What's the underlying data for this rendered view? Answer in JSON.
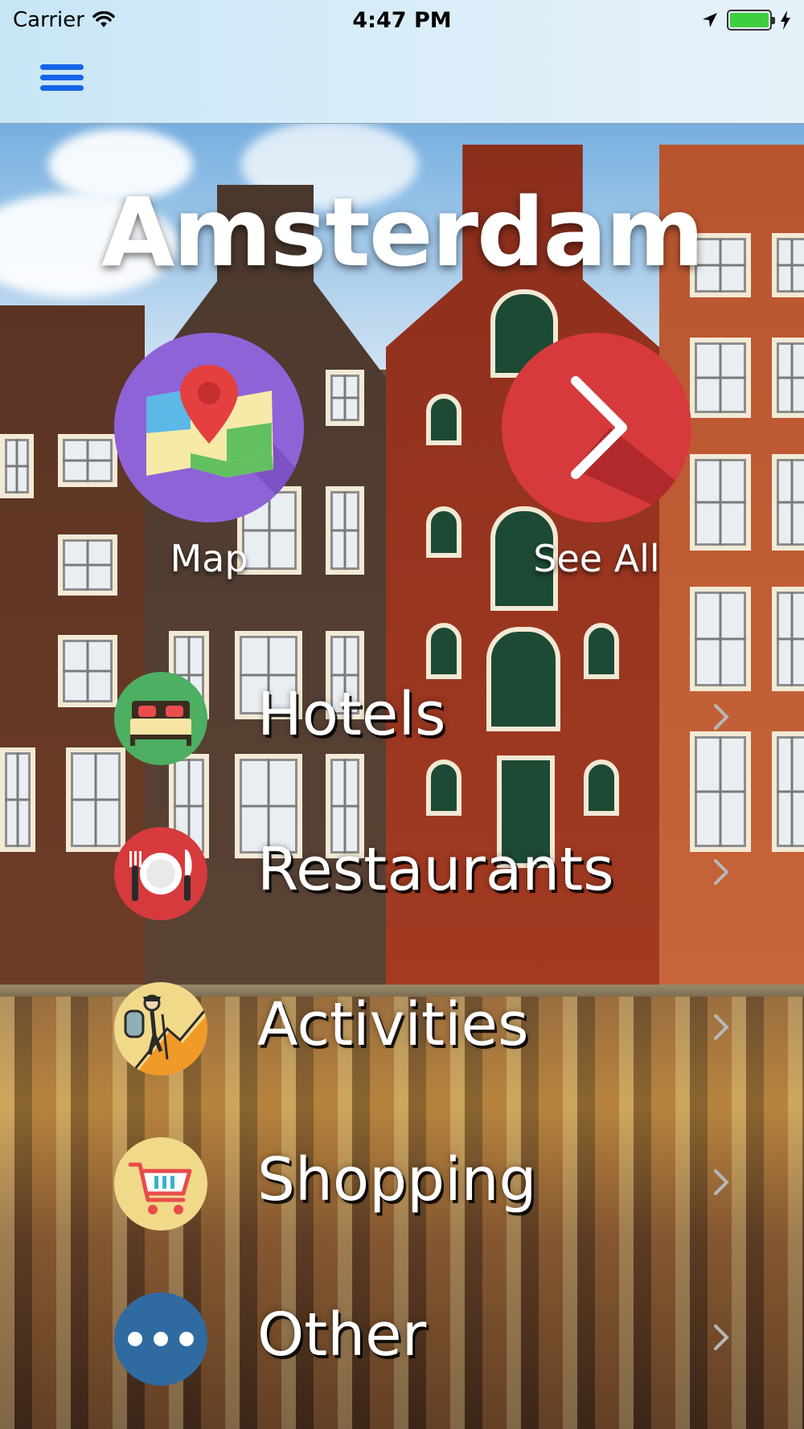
{
  "status_bar": {
    "carrier": "Carrier",
    "time": "4:47 PM",
    "battery_level": 1.0
  },
  "nav": {
    "menu_icon": "hamburger-menu-icon",
    "accent_color": "#1664e8"
  },
  "city": {
    "name": "Amsterdam"
  },
  "primary_actions": [
    {
      "label": "Map",
      "icon": "map-pin-icon",
      "color": "#8e63d8"
    },
    {
      "label": "See All",
      "icon": "chevron-right-icon",
      "color": "#d63a3c"
    }
  ],
  "categories": [
    {
      "label": "Hotels",
      "icon": "bed-icon",
      "color": "#4caf62"
    },
    {
      "label": "Restaurants",
      "icon": "plate-cutlery-icon",
      "color": "#d63a3c"
    },
    {
      "label": "Activities",
      "icon": "hiker-icon",
      "color": "#f1d98a"
    },
    {
      "label": "Shopping",
      "icon": "shopping-cart-icon",
      "color": "#f1d98a"
    },
    {
      "label": "Other",
      "icon": "more-dots-icon",
      "color": "#2f6aa1"
    }
  ]
}
